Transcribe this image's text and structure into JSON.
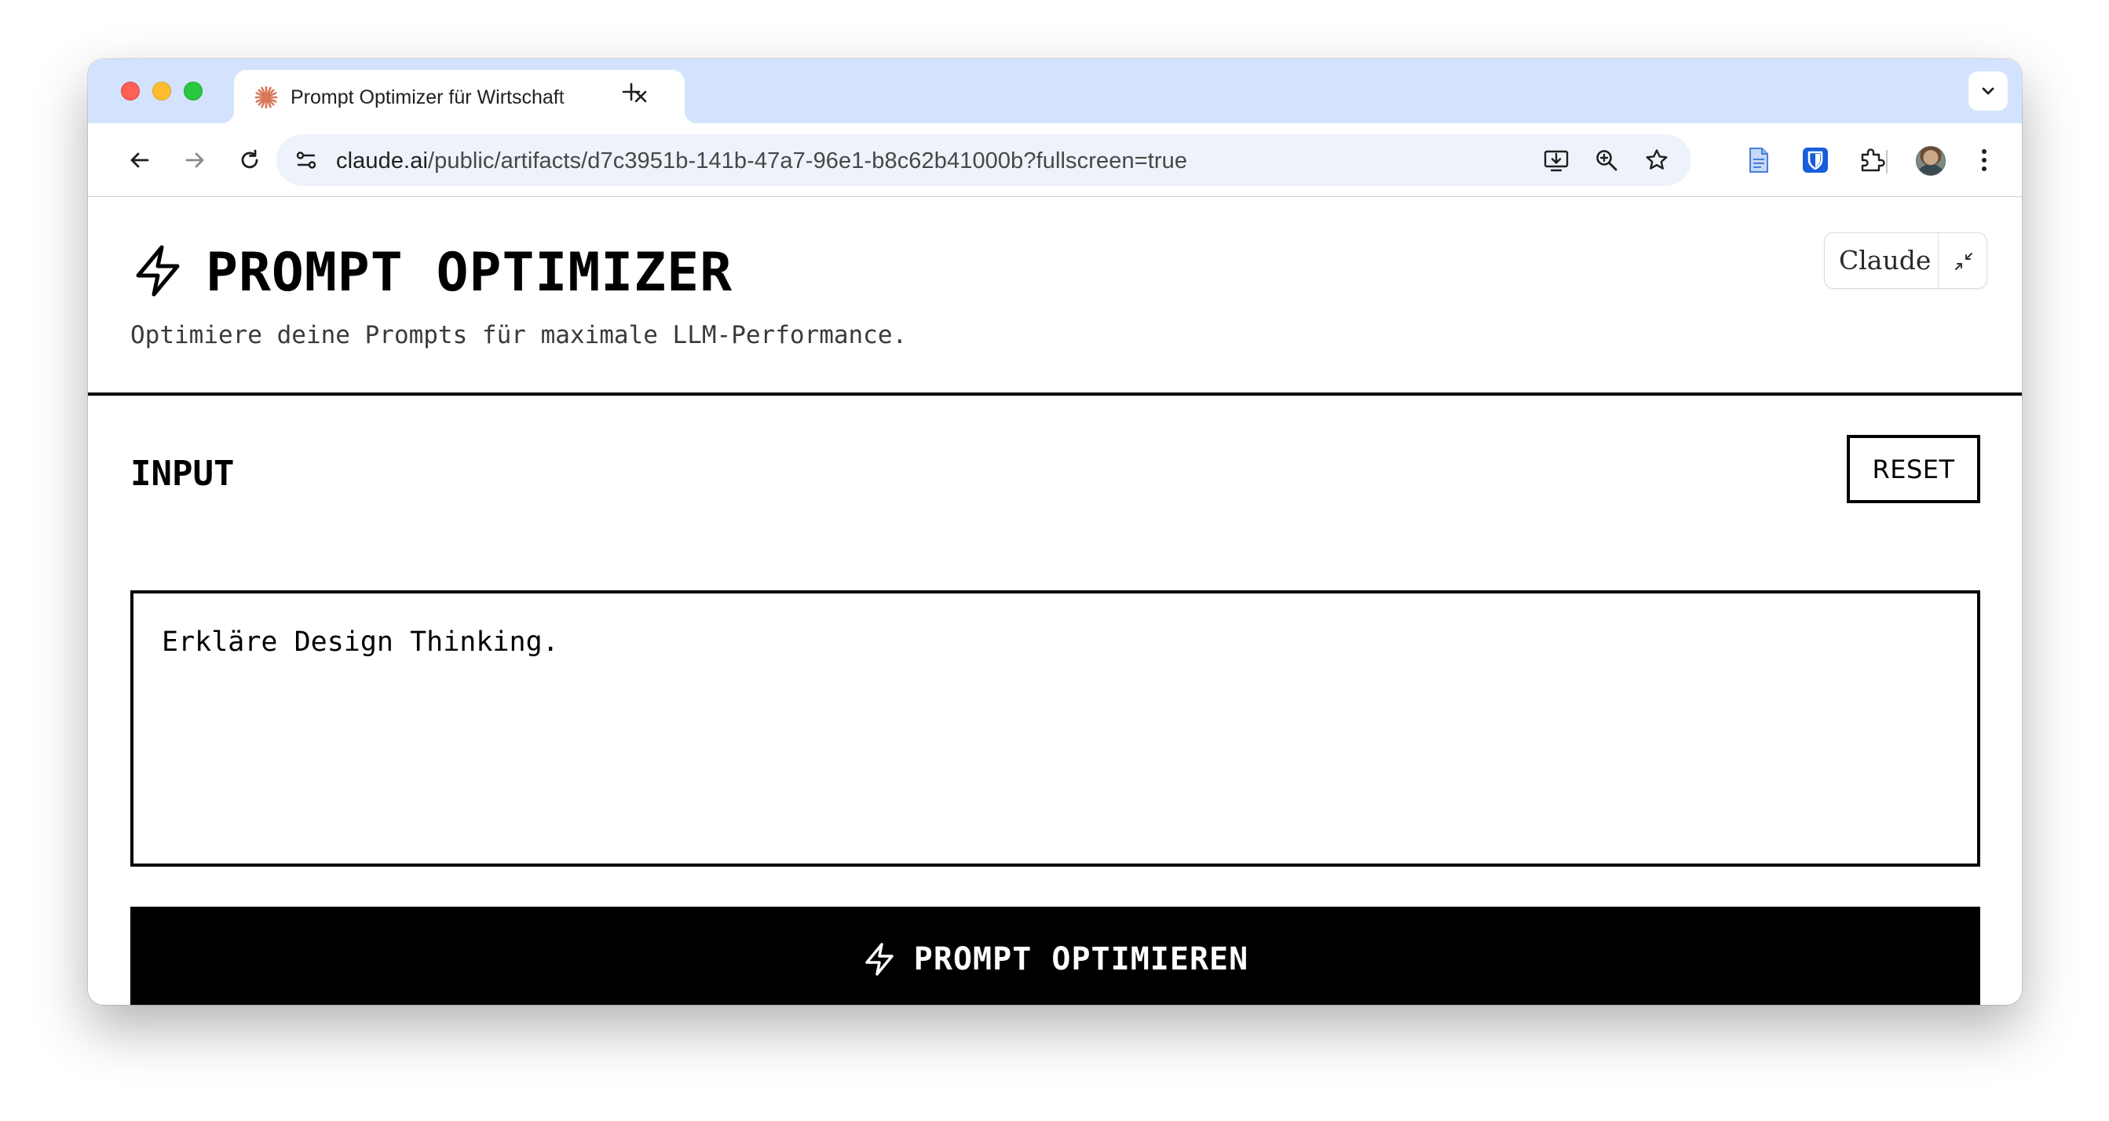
{
  "browser": {
    "tab": {
      "title": "Prompt Optimizer für Wirtschaft",
      "favicon": "claude-sunburst-icon",
      "favicon_color": "#d97757"
    },
    "address_bar": {
      "domain": "claude.ai",
      "path": "/public/artifacts/d7c3951b-141b-47a7-96e1-b8c62b41000b?fullscreen=true"
    },
    "toolbar_icons": [
      "back-icon",
      "forward-icon",
      "reload-icon",
      "site-info-icon",
      "install-app-icon",
      "zoom-icon",
      "bookmark-star-icon",
      "docs-extension-icon",
      "bitwarden-extension-icon",
      "extensions-puzzle-icon",
      "profile-avatar",
      "menu-kebab-icon"
    ],
    "colors": {
      "tabstrip": "#d3e3fd",
      "omnibox": "#eef2fa"
    }
  },
  "app": {
    "title": "PROMPT OPTIMIZER",
    "subtitle": "Optimiere deine Prompts für maximale LLM-Performance.",
    "badge": {
      "label": "Claude"
    },
    "input": {
      "section_label": "INPUT",
      "reset_label": "RESET",
      "value": "Erkläre Design Thinking."
    },
    "optimize_button": {
      "label": "PROMPT OPTIMIEREN",
      "icon": "lightning-bolt-icon"
    },
    "colors": {
      "primary": "#000000",
      "background": "#ffffff"
    }
  }
}
